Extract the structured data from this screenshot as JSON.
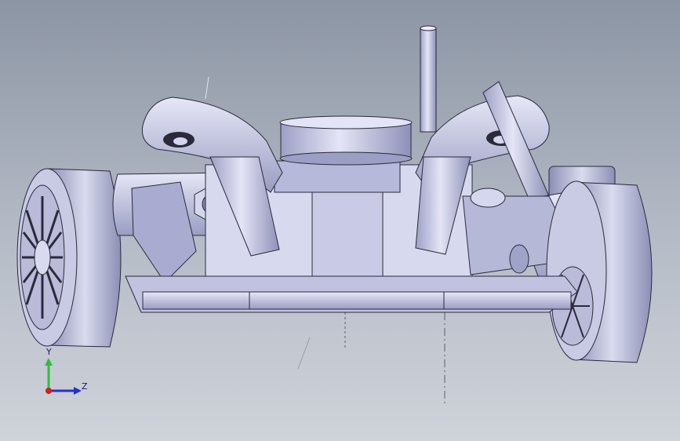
{
  "viewport": {
    "background_top": "#8c95a4",
    "background_bottom": "#cfd3da"
  },
  "model": {
    "part_color": "#c6c8e6",
    "part_shadow": "#7f82a8",
    "edge_color": "#2a2a3a",
    "tire_color": "#b4b6d2"
  },
  "triad": {
    "y_label": "Y",
    "z_label": "Z",
    "y_color": "#2fbf3a",
    "z_color": "#2233cc",
    "x_color": "#cc2222"
  }
}
